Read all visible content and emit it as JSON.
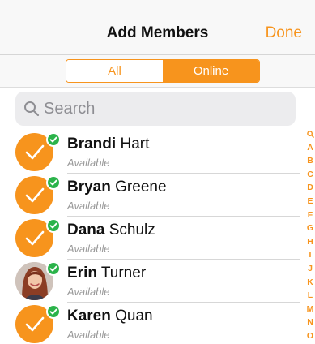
{
  "navbar": {
    "title": "Add Members",
    "done_label": "Done"
  },
  "segmented": {
    "all_label": "All",
    "online_label": "Online",
    "selected": "Online"
  },
  "search": {
    "placeholder": "Search",
    "icon": "search-icon"
  },
  "contacts": [
    {
      "first": "Brandi",
      "last": "Hart",
      "status": "Available",
      "avatar": "check-avatar",
      "online": true
    },
    {
      "first": "Bryan",
      "last": "Greene",
      "status": "Available",
      "avatar": "check-avatar",
      "online": true
    },
    {
      "first": "Dana",
      "last": "Schulz",
      "status": "Available",
      "avatar": "check-avatar",
      "online": true
    },
    {
      "first": "Erin",
      "last": "Turner",
      "status": "Available",
      "avatar": "photo-avatar",
      "online": true
    },
    {
      "first": "Karen",
      "last": "Quan",
      "status": "Available",
      "avatar": "check-avatar",
      "online": true
    }
  ],
  "index": {
    "search_icon": "search-icon",
    "letters": [
      "A",
      "B",
      "C",
      "D",
      "E",
      "F",
      "G",
      "H",
      "I",
      "J",
      "K",
      "L",
      "M",
      "N",
      "O"
    ]
  },
  "colors": {
    "accent": "#f7941d",
    "online": "#2bb34a",
    "secondary_text": "#9a9a9a"
  }
}
